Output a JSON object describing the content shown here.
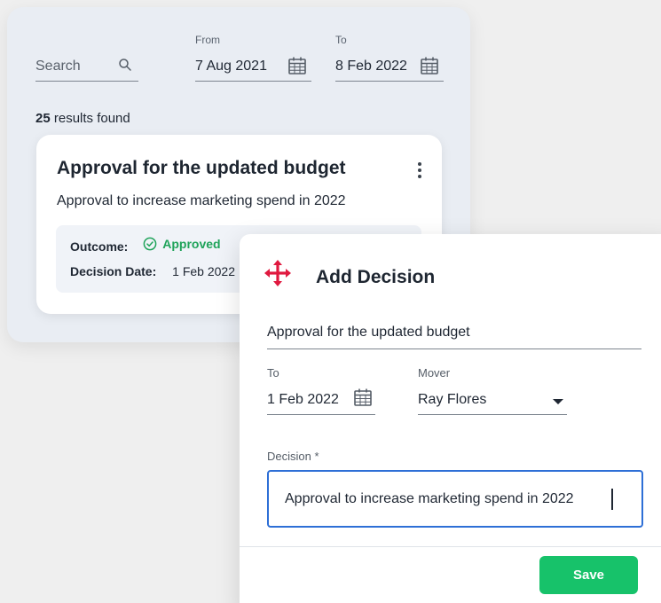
{
  "search": {
    "placeholder": "Search",
    "from_label": "From",
    "from_value": "7 Aug 2021",
    "to_label": "To",
    "to_value": "8 Feb 2022"
  },
  "results": {
    "count": "25",
    "suffix": " results found"
  },
  "card": {
    "title": "Approval for the updated budget",
    "description": "Approval to increase marketing spend in 2022",
    "outcome_label": "Outcome:",
    "outcome_value": "Approved",
    "date_label": "Decision Date:",
    "date_value": "1 Feb 2022"
  },
  "modal": {
    "title": "Add Decision",
    "subject_value": "Approval for the updated budget",
    "to_label": "To",
    "to_value": "1 Feb 2022",
    "mover_label": "Mover",
    "mover_value": "Ray Flores",
    "decision_label": "Decision *",
    "decision_value": "Approval to increase marketing spend in 2022",
    "save_label": "Save"
  },
  "colors": {
    "accent_green": "#17c26a",
    "approved_green": "#1fa35a",
    "focus_blue": "#2e6fd6",
    "icon_red": "#e0193f"
  },
  "icons": {
    "search": "search-icon",
    "calendar": "calendar-icon",
    "more": "more-vertical-icon",
    "check": "check-circle-icon",
    "move": "move-arrows-icon",
    "dropdown": "caret-down-icon"
  }
}
